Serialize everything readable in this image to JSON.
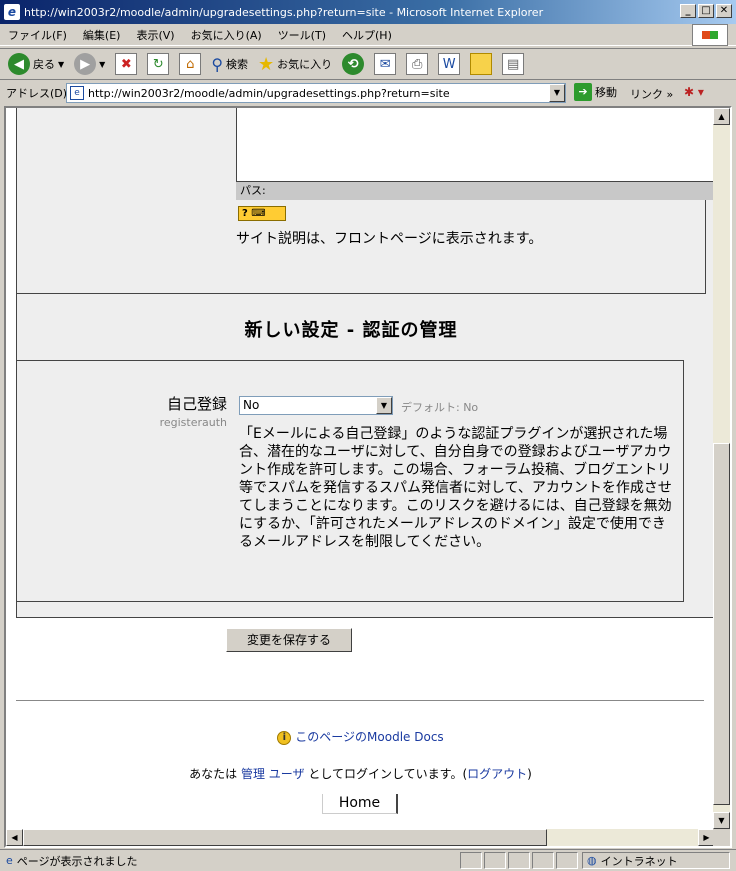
{
  "window": {
    "title": "http://win2003r2/moodle/admin/upgradesettings.php?return=site - Microsoft Internet Explorer",
    "min": "_",
    "max": "□",
    "close": "✕"
  },
  "menu": [
    "ファイル(F)",
    "編集(E)",
    "表示(V)",
    "お気に入り(A)",
    "ツール(T)",
    "ヘルプ(H)"
  ],
  "toolbar": {
    "back": "戻る",
    "search": "検索",
    "favorites": "お気に入り"
  },
  "address": {
    "label": "アドレス(D)",
    "url": "http://win2003r2/moodle/admin/upgradesettings.php?return=site",
    "go": "移動",
    "links": "リンク »"
  },
  "page": {
    "path_label": "パス:",
    "help_badge": "? ",
    "site_description": "サイト説明は、フロントページに表示されます。",
    "section_title": "新しい設定 - 認証の管理",
    "setting": {
      "label": "自己登録",
      "key": "registerauth",
      "selected": "No",
      "default": "デフォルト: No",
      "description": "「Eメールによる自己登録」のような認証プラグインが選択された場合、潜在的なユーザに対して、自分自身での登録およびユーザアカウント作成を許可します。この場合、フォーラム投稿、ブログエントリ等でスパムを発信するスパム発信者に対して、アカウントを作成させてしまうことになります。このリスクを避けるには、自己登録を無効にするか、「許可されたメールアドレスのドメイン」設定で使用できるメールアドレスを制限してください。"
    },
    "save_button": "変更を保存する",
    "docs_link": "このページのMoodle Docs",
    "login_prefix": "あなたは ",
    "login_user": "管理 ユーザ",
    "login_mid": " としてログインしています。(",
    "logout": "ログアウト",
    "login_suffix": ")",
    "home": "Home"
  },
  "status": {
    "text": "ページが表示されました",
    "zone": "イントラネット"
  }
}
